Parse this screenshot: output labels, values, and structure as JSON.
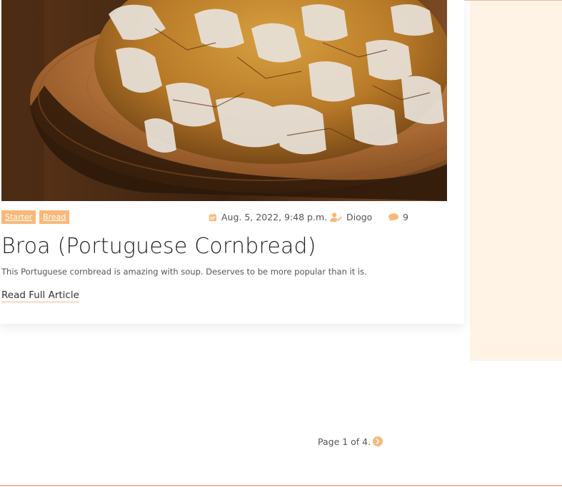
{
  "colors": {
    "accent": "#f8b878",
    "accent_line": "#f2b59e",
    "sidebar_bg": "#fff3e6"
  },
  "post": {
    "image_alt": "Broa (Portuguese Cornbread)",
    "tags": [
      "Starter",
      "Bread"
    ],
    "date": "Aug. 5, 2022, 9:48 p.m.",
    "author": "Diogo",
    "comment_count": "9",
    "title": "Broa (Portuguese Cornbread)",
    "excerpt": "This Portuguese cornbread is amazing with soup. Deserves to be more popular than it is.",
    "read_more": "Read Full Article"
  },
  "pagination": {
    "text": "Page 1 of 4."
  },
  "icons": {
    "date": "calendar-icon",
    "author": "user-edit-icon",
    "comments": "comment-icon",
    "next": "chevron-right-circle-icon"
  }
}
